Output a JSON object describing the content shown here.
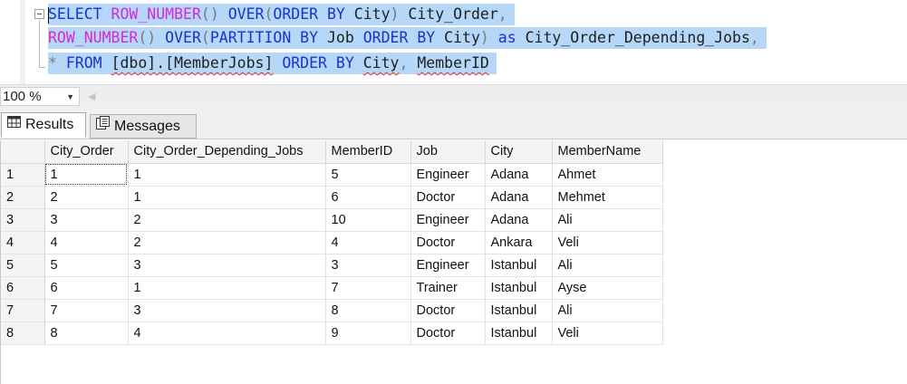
{
  "editor": {
    "line1": [
      {
        "t": "SELECT",
        "c": "kw"
      },
      {
        "t": " ",
        "c": "tx"
      },
      {
        "t": "ROW_NUMBER",
        "c": "fn"
      },
      {
        "t": "() ",
        "c": "gr"
      },
      {
        "t": "OVER",
        "c": "kw"
      },
      {
        "t": "(",
        "c": "gr"
      },
      {
        "t": "ORDER BY",
        "c": "kw"
      },
      {
        "t": " City",
        "c": "tx"
      },
      {
        "t": ") ",
        "c": "gr"
      },
      {
        "t": "City_Order",
        "c": "tx"
      },
      {
        "t": ",",
        "c": "gr"
      }
    ],
    "line2": [
      {
        "t": "ROW_NUMBER",
        "c": "fn"
      },
      {
        "t": "() ",
        "c": "gr"
      },
      {
        "t": "OVER",
        "c": "kw"
      },
      {
        "t": "(",
        "c": "gr"
      },
      {
        "t": "PARTITION BY",
        "c": "kw"
      },
      {
        "t": " Job ",
        "c": "tx"
      },
      {
        "t": "ORDER BY",
        "c": "kw"
      },
      {
        "t": " City",
        "c": "tx"
      },
      {
        "t": ") ",
        "c": "gr"
      },
      {
        "t": "as",
        "c": "kw"
      },
      {
        "t": " City_Order_Depending_Jobs",
        "c": "tx"
      },
      {
        "t": ",",
        "c": "gr"
      }
    ],
    "line3": [
      {
        "t": "*",
        "c": "gr"
      },
      {
        "t": " ",
        "c": "tx"
      },
      {
        "t": "FROM",
        "c": "kw"
      },
      {
        "t": " ",
        "c": "tx"
      },
      {
        "t": "[dbo].[MemberJobs]",
        "c": "tx",
        "squig": true
      },
      {
        "t": " ",
        "c": "tx"
      },
      {
        "t": "ORDER BY",
        "c": "kw"
      },
      {
        "t": " ",
        "c": "tx"
      },
      {
        "t": "City",
        "c": "tx",
        "squig": true
      },
      {
        "t": ", ",
        "c": "gr"
      },
      {
        "t": "MemberID",
        "c": "tx",
        "squig": true
      }
    ]
  },
  "zoom": {
    "value": "100 %"
  },
  "tabs": {
    "results": "Results",
    "messages": "Messages"
  },
  "grid": {
    "columns": [
      "",
      "City_Order",
      "City_Order_Depending_Jobs",
      "MemberID",
      "Job",
      "City",
      "MemberName"
    ],
    "rows": [
      [
        "1",
        "1",
        "1",
        "5",
        "Engineer",
        "Adana",
        "Ahmet"
      ],
      [
        "2",
        "2",
        "1",
        "6",
        "Doctor",
        "Adana",
        "Mehmet"
      ],
      [
        "3",
        "3",
        "2",
        "10",
        "Engineer",
        "Adana",
        "Ali"
      ],
      [
        "4",
        "4",
        "2",
        "4",
        "Doctor",
        "Ankara",
        "Veli"
      ],
      [
        "5",
        "5",
        "3",
        "3",
        "Engineer",
        "Istanbul",
        "Ali"
      ],
      [
        "6",
        "6",
        "1",
        "7",
        "Trainer",
        "Istanbul",
        "Ayse"
      ],
      [
        "7",
        "7",
        "3",
        "8",
        "Doctor",
        "Istanbul",
        "Ali"
      ],
      [
        "8",
        "8",
        "4",
        "9",
        "Doctor",
        "Istanbul",
        "Veli"
      ]
    ]
  },
  "colors": {
    "selection": "#b6d7f8",
    "keyword": "#1a33c9",
    "function": "#d12ad6",
    "operator": "#7a7a7a"
  }
}
